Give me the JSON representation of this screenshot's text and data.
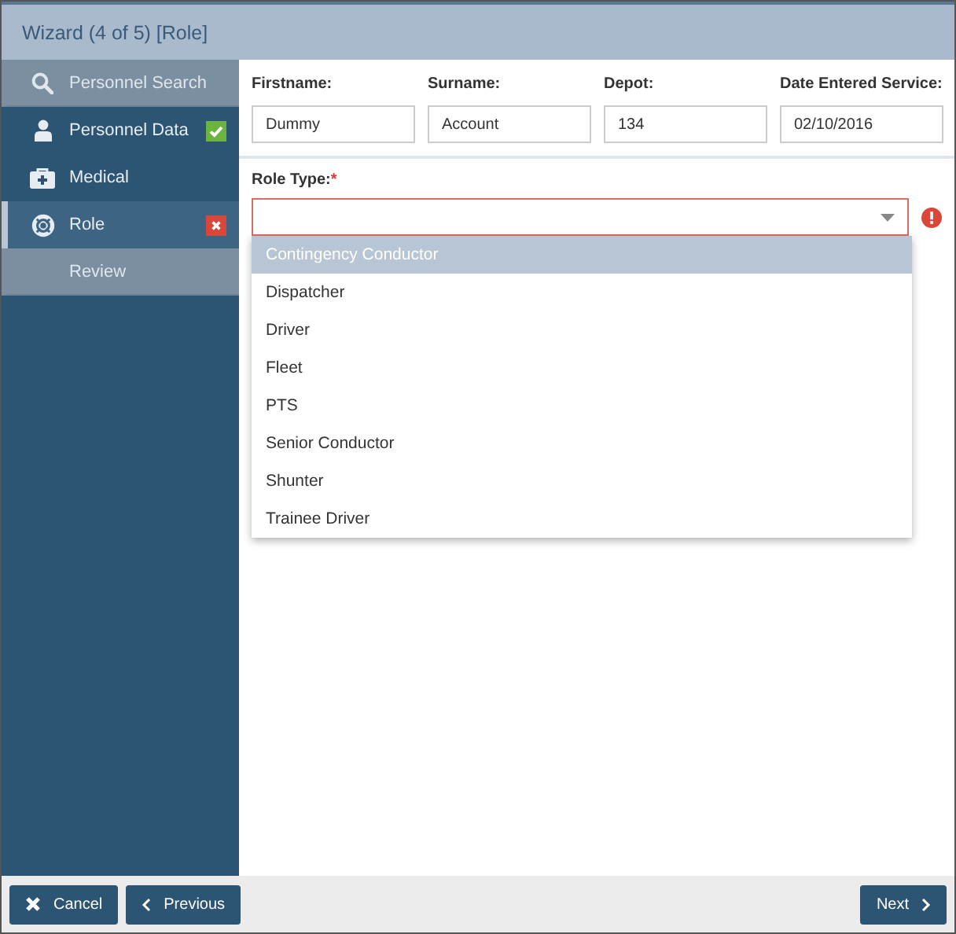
{
  "window": {
    "title": "Wizard (4 of 5) [Role]"
  },
  "sidebar": {
    "items": [
      {
        "label": "Personnel Search",
        "disabled": true,
        "selected": false,
        "completed": false,
        "invalid": false
      },
      {
        "label": "Personnel Data",
        "disabled": false,
        "selected": false,
        "completed": true,
        "invalid": false
      },
      {
        "label": "Medical",
        "disabled": false,
        "selected": false,
        "completed": false,
        "invalid": false
      },
      {
        "label": "Role",
        "disabled": false,
        "selected": true,
        "completed": false,
        "invalid": true
      },
      {
        "label": "Review",
        "disabled": true,
        "selected": false,
        "completed": false,
        "invalid": false
      }
    ]
  },
  "fields": [
    {
      "label": "Firstname:",
      "value": "Dummy"
    },
    {
      "label": "Surname:",
      "value": "Account"
    },
    {
      "label": "Depot:",
      "value": "134"
    },
    {
      "label": "Date Entered Service:",
      "value": "02/10/2016"
    }
  ],
  "role_type": {
    "label": "Role Type:",
    "required_mark": "*",
    "invalid": true,
    "expanded": true,
    "options": [
      {
        "label": "Contingency Conductor",
        "selected": true
      },
      {
        "label": "Dispatcher",
        "selected": false
      },
      {
        "label": "Driver",
        "selected": false
      },
      {
        "label": "Fleet",
        "selected": false
      },
      {
        "label": "PTS",
        "selected": false
      },
      {
        "label": "Senior Conductor",
        "selected": false
      },
      {
        "label": "Shunter",
        "selected": false
      },
      {
        "label": "Trainee Driver",
        "selected": false
      }
    ]
  },
  "footer": {
    "buttons": [
      {
        "label": "Cancel",
        "kind": "cancel"
      },
      {
        "label": "Previous",
        "kind": "previous"
      },
      {
        "label": "Next",
        "kind": "next"
      }
    ]
  }
}
